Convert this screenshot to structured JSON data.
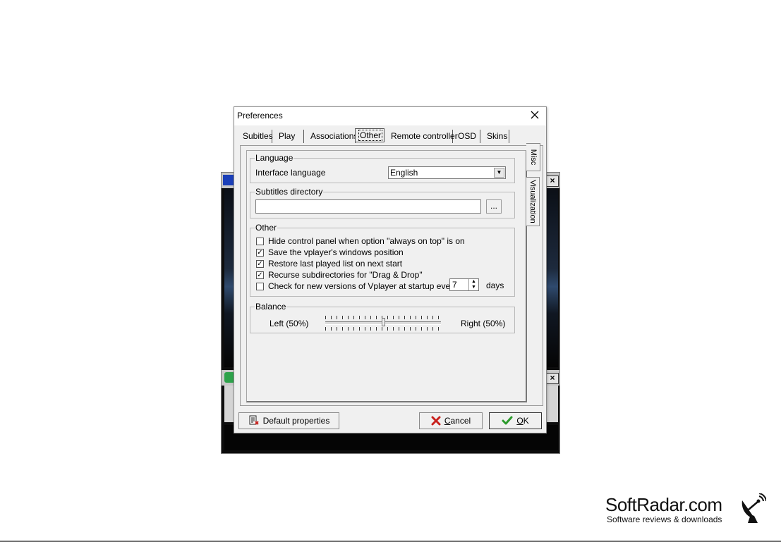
{
  "dialog": {
    "title": "Preferences",
    "tabs": [
      "Subitles",
      "Play",
      "Associations",
      "Other",
      "Remote controller",
      "OSD",
      "Skins"
    ],
    "active_tab": "Other",
    "side_tabs": [
      "Misc",
      "Visualization"
    ],
    "language": {
      "group_title": "Language",
      "label": "Interface language",
      "value": "English"
    },
    "subtitles": {
      "group_title": "Subtitles directory",
      "path_value": "",
      "browse_label": "..."
    },
    "other": {
      "group_title": "Other",
      "options": [
        {
          "label": "Hide control panel when option \"always on top\" is on",
          "checked": false
        },
        {
          "label": "Save the vplayer's windows position",
          "checked": true
        },
        {
          "label": "Restore last played list on next start",
          "checked": true
        },
        {
          "label": "Recurse subdirectories for \"Drag & Drop\"",
          "checked": true
        },
        {
          "label": "Check for new versions of Vplayer at startup every",
          "checked": false
        }
      ],
      "days_value": "7",
      "days_unit": "days"
    },
    "balance": {
      "group_title": "Balance",
      "left_label": "Left (50%)",
      "right_label": "Right (50%)",
      "value_percent": 50
    },
    "buttons": {
      "default": "Default properties",
      "cancel_pre": "",
      "cancel_u": "C",
      "cancel_rest": "ancel",
      "ok_u": "O",
      "ok_rest": "K"
    }
  },
  "watermark": {
    "title": "SoftRadar.com",
    "subtitle": "Software reviews & downloads"
  },
  "icons": {
    "close": "close-icon",
    "dropdown": "chevron-down-icon",
    "default_props": "document-properties-icon",
    "cancel": "red-x-icon",
    "ok": "green-check-icon",
    "watermark": "satellite-dish-icon"
  },
  "colors": {
    "dialog_bg": "#f0f0f0",
    "cancel_icon": "#c8201c",
    "ok_icon": "#2b9a2b"
  }
}
